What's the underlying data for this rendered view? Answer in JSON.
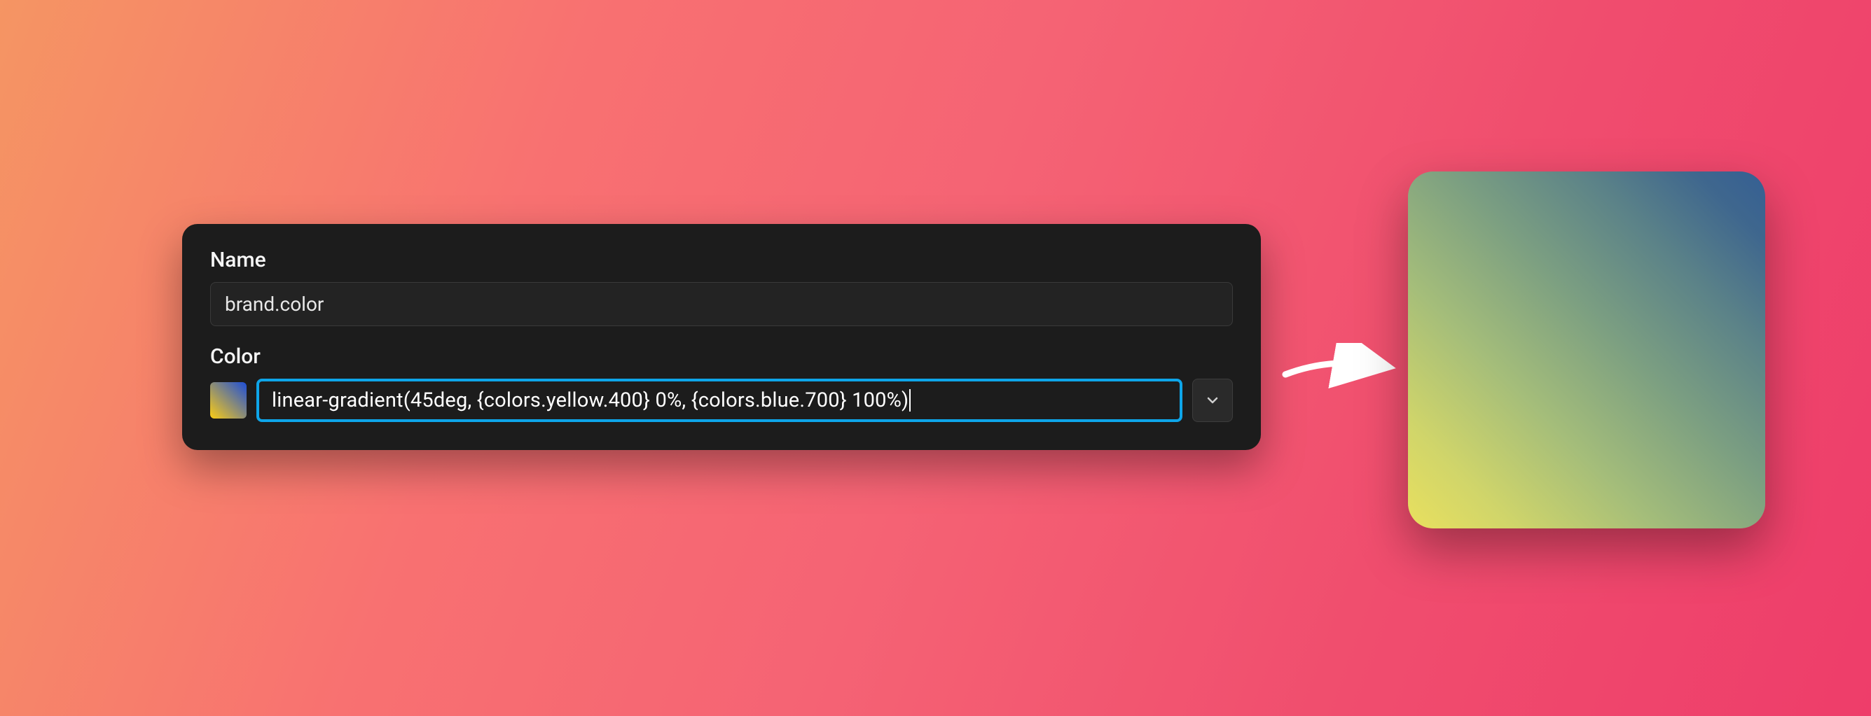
{
  "form": {
    "name_label": "Name",
    "name_value": "brand.color",
    "color_label": "Color",
    "color_value": "linear-gradient(45deg, {colors.yellow.400} 0%, {colors.blue.700} 100%)"
  },
  "swatch_gradient": {
    "angle": "45deg",
    "stops": [
      {
        "token": "colors.yellow.400",
        "hex": "#facc15",
        "position": "0%"
      },
      {
        "token": "colors.blue.700",
        "hex": "#1d4ed8",
        "position": "100%"
      }
    ]
  },
  "colors": {
    "focus_ring": "#0ea5e9",
    "panel_bg": "#1c1c1c",
    "input_bg": "#232323",
    "text": "#f5f5f5"
  }
}
